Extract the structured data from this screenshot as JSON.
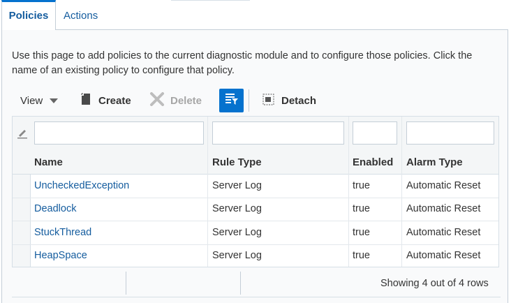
{
  "tabs": [
    {
      "label": "Policies",
      "active": true
    },
    {
      "label": "Actions",
      "active": false
    }
  ],
  "intro": "Use this page to add policies to the current diagnostic module and to configure those policies. Click the name of an existing policy to configure that policy.",
  "toolbar": {
    "view_label": "View",
    "create_label": "Create",
    "delete_label": "Delete",
    "detach_label": "Detach",
    "icons": {
      "view": "chevron-down-icon",
      "create": "create-document-icon",
      "delete": "close-icon",
      "filter": "query-by-example-icon",
      "detach": "detach-icon"
    }
  },
  "table": {
    "columns": [
      "Name",
      "Rule Type",
      "Enabled",
      "Alarm Type"
    ],
    "rows": [
      {
        "name": "UncheckedException",
        "rule_type": "Server Log",
        "enabled": "true",
        "alarm_type": "Automatic Reset"
      },
      {
        "name": "Deadlock",
        "rule_type": "Server Log",
        "enabled": "true",
        "alarm_type": "Automatic Reset"
      },
      {
        "name": "StuckThread",
        "rule_type": "Server Log",
        "enabled": "true",
        "alarm_type": "Automatic Reset"
      },
      {
        "name": "HeapSpace",
        "rule_type": "Server Log",
        "enabled": "true",
        "alarm_type": "Automatic Reset"
      }
    ]
  },
  "footer": {
    "status": "Showing 4 out of 4 rows"
  },
  "colors": {
    "accent": "#0572ce",
    "link": "#145c9e",
    "border": "#c4ced7"
  }
}
